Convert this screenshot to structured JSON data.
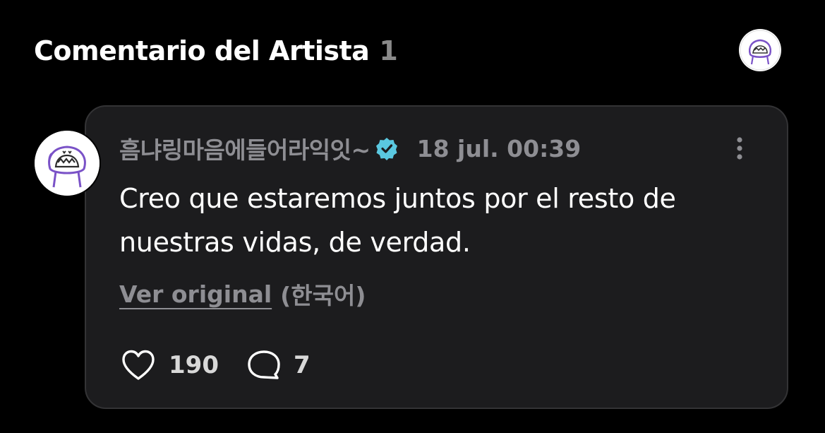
{
  "header": {
    "title": "Comentario del Artista",
    "count": "1",
    "avatar_icon": "artist-avatar-icon"
  },
  "comment": {
    "author": "흠냐링마음에들어라익잇~",
    "verified_icon": "verified-badge-icon",
    "timestamp": "18 jul. 00:39",
    "more_icon": "more-vertical-icon",
    "text": "Creo que estaremos juntos por el resto de nuestras vidas, de verdad.",
    "view_original_label": "Ver original",
    "original_language": "(한국어)",
    "likes": "190",
    "replies": "7",
    "like_icon": "heart-icon",
    "reply_icon": "comment-bubble-icon"
  },
  "colors": {
    "background": "#000000",
    "card": "#1c1c1e",
    "muted_text": "#8e8e93",
    "verified": "#5ac8e0",
    "avatar_sketch": "#7a52c7"
  }
}
